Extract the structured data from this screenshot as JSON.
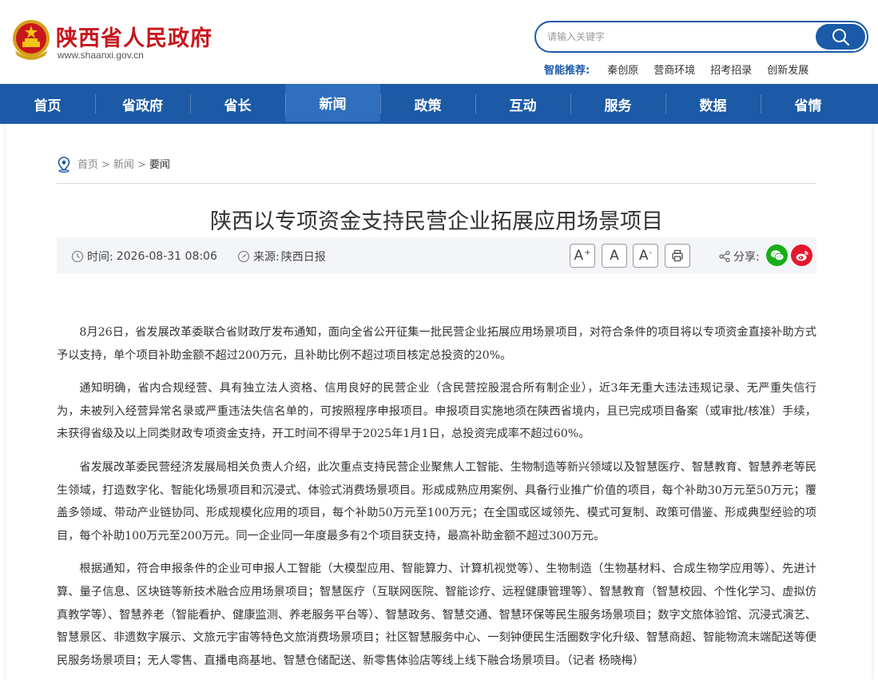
{
  "header": {
    "site_title": "陕西省人民政府",
    "site_url": "www.shaanxi.gov.cn",
    "search_placeholder": "请输入关键字",
    "recommend_label": "智能推荐:",
    "recommend_links": [
      "秦创原",
      "营商环境",
      "招考招录",
      "创新发展"
    ]
  },
  "nav": {
    "items": [
      "首页",
      "省政府",
      "省长",
      "新闻",
      "政策",
      "互动",
      "服务",
      "数据",
      "省情"
    ],
    "active": "新闻"
  },
  "breadcrumb": {
    "items": [
      "首页",
      "新闻",
      "要闻"
    ],
    "separator": ">"
  },
  "article": {
    "title": "陕西以专项资金支持民营企业拓展应用场景项目",
    "time_label": "时间:",
    "time_value": "2026-08-31 08:06",
    "source_label": "来源:",
    "source_value": "陕西日报",
    "font_controls": {
      "large": "A",
      "medium": "A",
      "small": "A",
      "large_mark": "+",
      "small_mark": "-"
    },
    "share_label": "分享:",
    "paragraphs": [
      "8月26日，省发展改革委联合省财政厅发布通知，面向全省公开征集一批民营企业拓展应用场景项目，对符合条件的项目将以专项资金直接补助方式予以支持，单个项目补助金额不超过200万元，且补助比例不超过项目核定总投资的20%。",
      "通知明确，省内合规经营、具有独立法人资格、信用良好的民营企业（含民营控股混合所有制企业），近3年无重大违法违规记录、无严重失信行为，未被列入经营异常名录或严重违法失信名单的，可按照程序申报项目。申报项目实施地须在陕西省境内，且已完成项目备案（或审批/核准）手续，未获得省级及以上同类财政专项资金支持，开工时间不得早于2025年1月1日，总投资完成率不超过60%。",
      "省发展改革委民营经济发展局相关负责人介绍，此次重点支持民营企业聚焦人工智能、生物制造等新兴领域以及智慧医疗、智慧教育、智慧养老等民生领域，打造数字化、智能化场景项目和沉浸式、体验式消费场景项目。形成成熟应用案例、具备行业推广价值的项目，每个补助30万元至50万元；覆盖多领域、带动产业链协同、形成规模化应用的项目，每个补助50万元至100万元；在全国或区域领先、模式可复制、政策可借鉴、形成典型经验的项目，每个补助100万元至200万元。同一企业同一年度最多有2个项目获支持，最高补助金额不超过300万元。",
      "根据通知，符合申报条件的企业可申报人工智能（大模型应用、智能算力、计算机视觉等）、生物制造（生物基材料、合成生物学应用等）、先进计算、量子信息、区块链等新技术融合应用场景项目；智慧医疗（互联网医院、智能诊疗、远程健康管理等）、智慧教育（智慧校园、个性化学习、虚拟仿真教学等）、智慧养老（智能看护、健康监测、养老服务平台等）、智慧政务、智慧交通、智慧环保等民生服务场景项目；数字文旅体验馆、沉浸式演艺、智慧景区、非遗数字展示、文旅元宇宙等特色文旅消费场景项目；社区智慧服务中心、一刻钟便民生活圈数字化升级、智慧商超、智能物流末端配送等便民服务场景项目；无人零售、直播电商基地、智慧仓储配送、新零售体验店等线上线下融合场景项目。（记者 杨晓梅）"
    ]
  },
  "colors": {
    "brand_red": "#c8161d",
    "nav_blue": "#1c5aa6",
    "wechat_green": "#19ad19",
    "weibo_red": "#e6162d"
  }
}
